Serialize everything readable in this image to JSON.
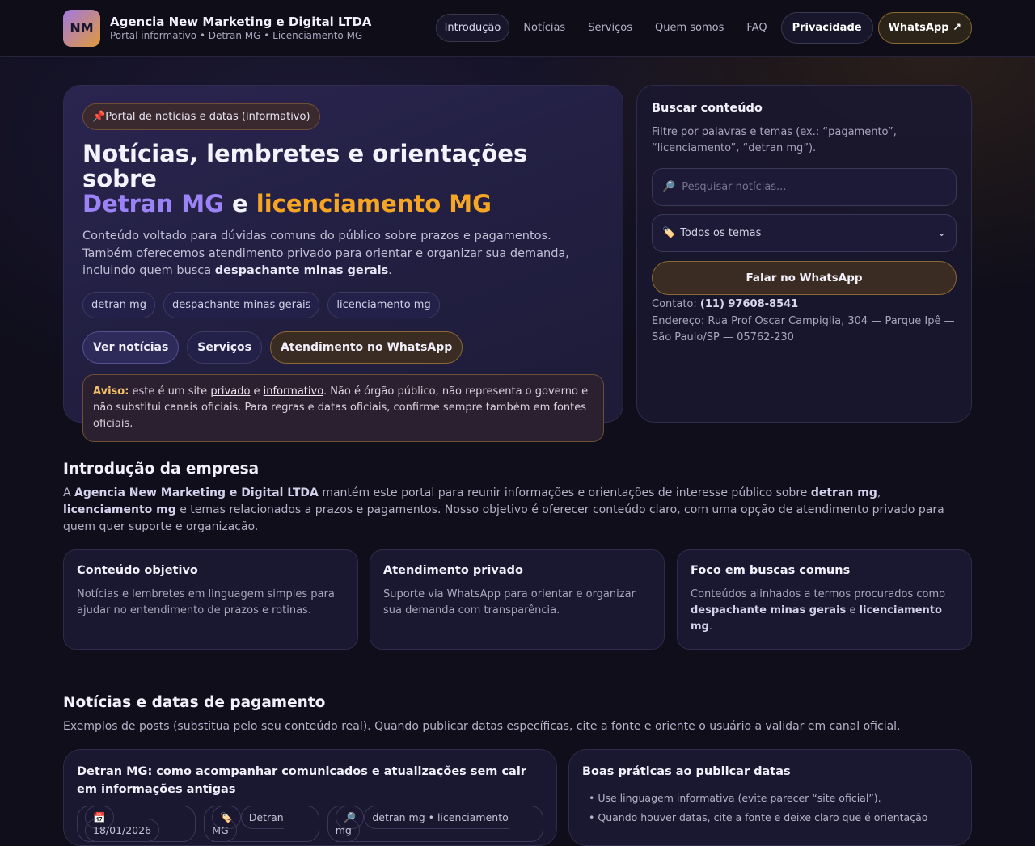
{
  "header": {
    "logo": "NM",
    "title": "Agencia New Marketing e Digital LTDA",
    "subtitle": "Portal informativo • Detran MG • Licenciamento MG",
    "nav": [
      "Introdução",
      "Notícias",
      "Serviços",
      "Quem somos",
      "FAQ",
      "Privacidade",
      "WhatsApp ↗"
    ]
  },
  "hero": {
    "pill": "Portal de notícias e datas (informativo)",
    "title_1": "Notícias, lembretes e orientações sobre",
    "title_purple": "Detran MG",
    "title_and": " e ",
    "title_orange": "licenciamento MG",
    "lead": "Conteúdo voltado para dúvidas comuns do público sobre prazos e pagamentos. Também oferecemos atendimento privado para orientar e organizar sua demanda, incluindo quem busca ",
    "lead_bold": "despachante minas gerais",
    "lead_end": ".",
    "tags": [
      "detran mg",
      "despachante minas gerais",
      "licenciamento mg"
    ],
    "buttons": [
      "Ver notícias",
      "Serviços",
      "Atendimento no WhatsApp"
    ],
    "notice": {
      "label": "Aviso:",
      "t1": " este é um site ",
      "u1": "privado",
      "t2": " e ",
      "u2": "informativo",
      "t3": ". Não é órgão público, não representa o governo e não substitui canais oficiais. Para regras e datas oficiais, confirme sempre também em fontes oficiais."
    }
  },
  "search": {
    "title": "Buscar conteúdo",
    "hint": "Filtre por palavras e temas (ex.: “pagamento”, “licenciamento”, “detran mg”).",
    "placeholder": "Pesquisar notícias...",
    "topic": "Todos os temas",
    "whatsapp": "Falar no WhatsApp",
    "contact_label": "Contato: ",
    "phone": "(11) 97608-8541",
    "address": "Endereço: Rua Prof Oscar Campiglia, 304 — Parque Ipê — São Paulo/SP — 05762-230"
  },
  "intro": {
    "title": "Introdução da empresa",
    "t1": "A ",
    "b1": "Agencia New Marketing e Digital LTDA",
    "t2": " mantém este portal para reunir informações e orientações de interesse público sobre ",
    "b2": "detran mg",
    "t3": ", ",
    "b3": "licenciamento mg",
    "t4": " e temas relacionados a prazos e pagamentos. Nosso objetivo é oferecer conteúdo claro, com uma opção de atendimento privado para quem quer suporte e organização.",
    "features": [
      {
        "title": "Conteúdo objetivo",
        "text": "Notícias e lembretes em linguagem simples para ajudar no entendimento de prazos e rotinas."
      },
      {
        "title": "Atendimento privado",
        "text": "Suporte via WhatsApp para orientar e organizar sua demanda com transparência."
      },
      {
        "title": "Foco em buscas comuns",
        "t1": "Conteúdos alinhados a termos procurados como ",
        "b1": "despachante minas gerais",
        "t2": " e ",
        "b2": "licenciamento mg",
        "t3": "."
      }
    ]
  },
  "news": {
    "title": "Notícias e datas de pagamento",
    "desc": "Exemplos de posts (substitua pelo seu conteúdo real). Quando publicar datas específicas, cite a fonte e oriente o usuário a validar em canal oficial.",
    "post": {
      "title": "Detran MG: como acompanhar comunicados e atualizações sem cair em informações antigas",
      "date": "18/01/2026",
      "category": "Detran MG",
      "keywords": "detran mg • licenciamento mg"
    },
    "tips": {
      "title": "Boas práticas ao publicar datas",
      "items": [
        "Use linguagem informativa (evite parecer “site oficial”).",
        "Quando houver datas, cite a fonte e deixe claro que é orientação"
      ]
    }
  }
}
